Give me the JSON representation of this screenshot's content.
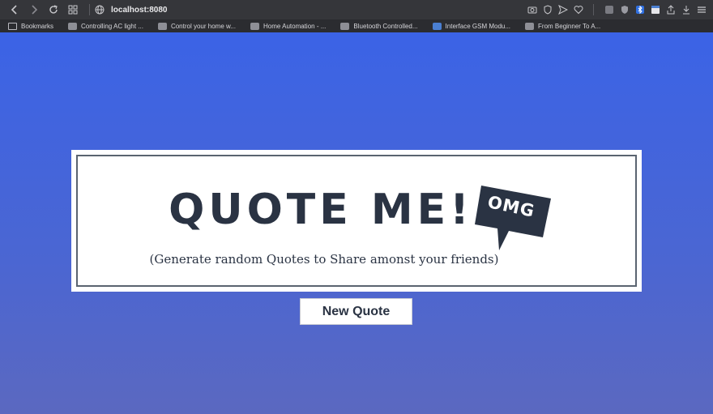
{
  "browser": {
    "url": "localhost:8080",
    "bookmarks": [
      {
        "label": "Bookmarks",
        "icon": "folder-icon"
      },
      {
        "label": "Controlling AC light ...",
        "icon": "site-icon"
      },
      {
        "label": "Control your home w...",
        "icon": "site-icon"
      },
      {
        "label": "Home Automation - ...",
        "icon": "site-icon"
      },
      {
        "label": "Bluetooth Controlled...",
        "icon": "site-icon"
      },
      {
        "label": "Interface GSM Modu...",
        "icon": "site-icon"
      },
      {
        "label": "From Beginner To A...",
        "icon": "site-icon"
      }
    ]
  },
  "app": {
    "title": "QUOTE ME!",
    "badge": "OMG",
    "subtitle": "(Generate random Quotes to Share amonst your friends)",
    "new_quote_label": "New Quote"
  },
  "colors": {
    "background_top": "#3b63e6",
    "background_bottom": "#5b68c0",
    "title_color": "#2a3343",
    "badge_color": "#2a3343"
  }
}
